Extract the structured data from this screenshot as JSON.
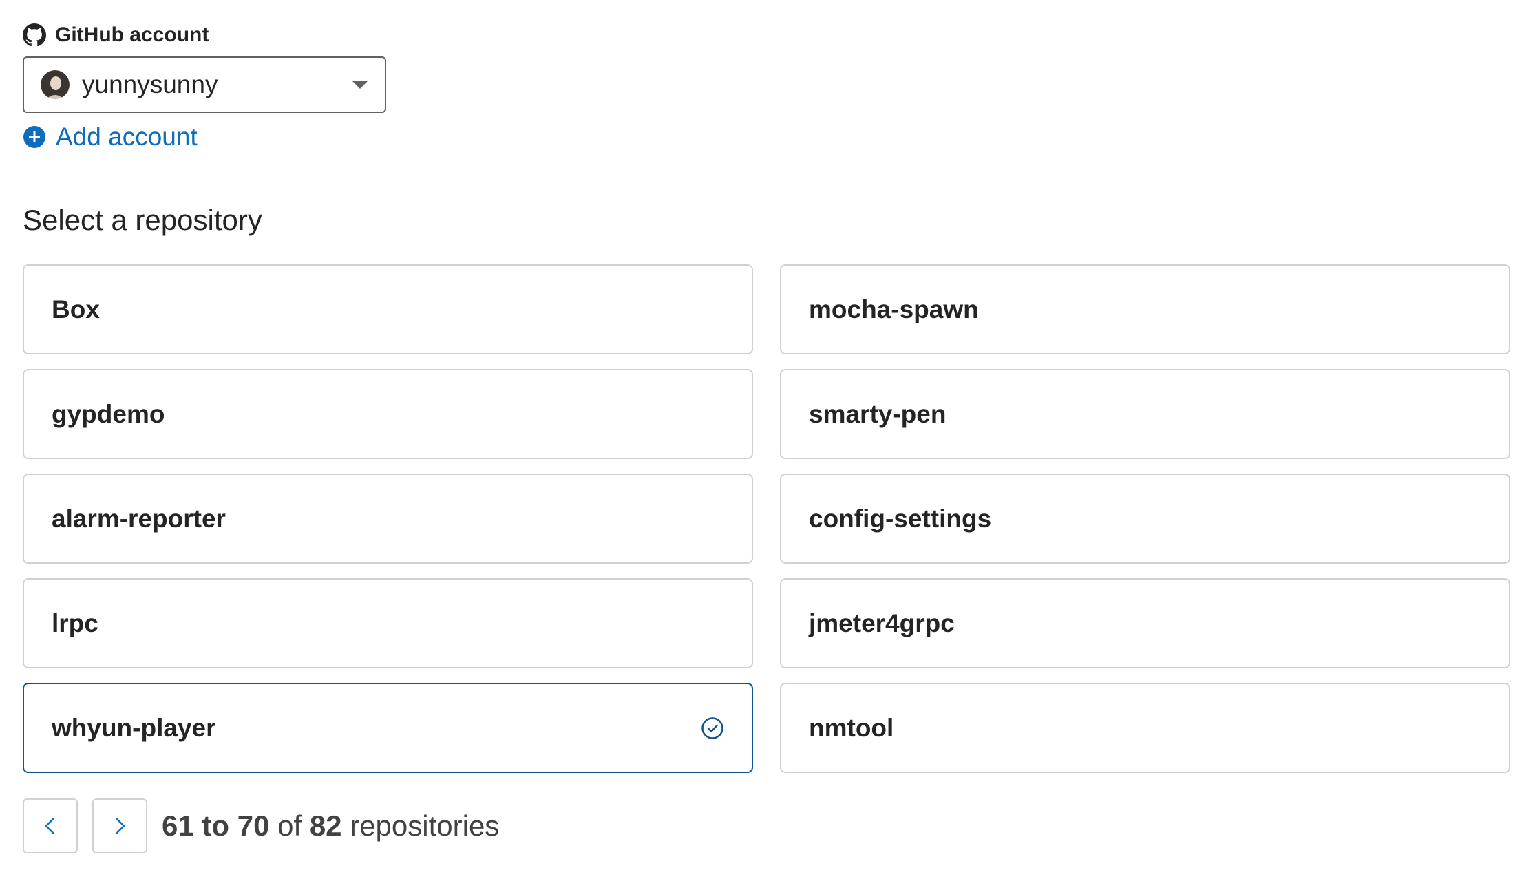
{
  "account": {
    "label": "GitHub account",
    "selected": "yunnysunny",
    "add_label": "Add account"
  },
  "repositories": {
    "title": "Select a repository",
    "items": [
      {
        "name": "Box",
        "selected": false
      },
      {
        "name": "mocha-spawn",
        "selected": false
      },
      {
        "name": "gypdemo",
        "selected": false
      },
      {
        "name": "smarty-pen",
        "selected": false
      },
      {
        "name": "alarm-reporter",
        "selected": false
      },
      {
        "name": "config-settings",
        "selected": false
      },
      {
        "name": "lrpc",
        "selected": false
      },
      {
        "name": "jmeter4grpc",
        "selected": false
      },
      {
        "name": "whyun-player",
        "selected": true
      },
      {
        "name": "nmtool",
        "selected": false
      }
    ]
  },
  "pagination": {
    "range_start": "61",
    "to": "to",
    "range_end": "70",
    "of": "of",
    "total": "82",
    "unit": "repositories"
  },
  "colors": {
    "accent": "#0f6cbd",
    "selected_border": "#0f548c",
    "card_border": "#d1d1d1"
  }
}
